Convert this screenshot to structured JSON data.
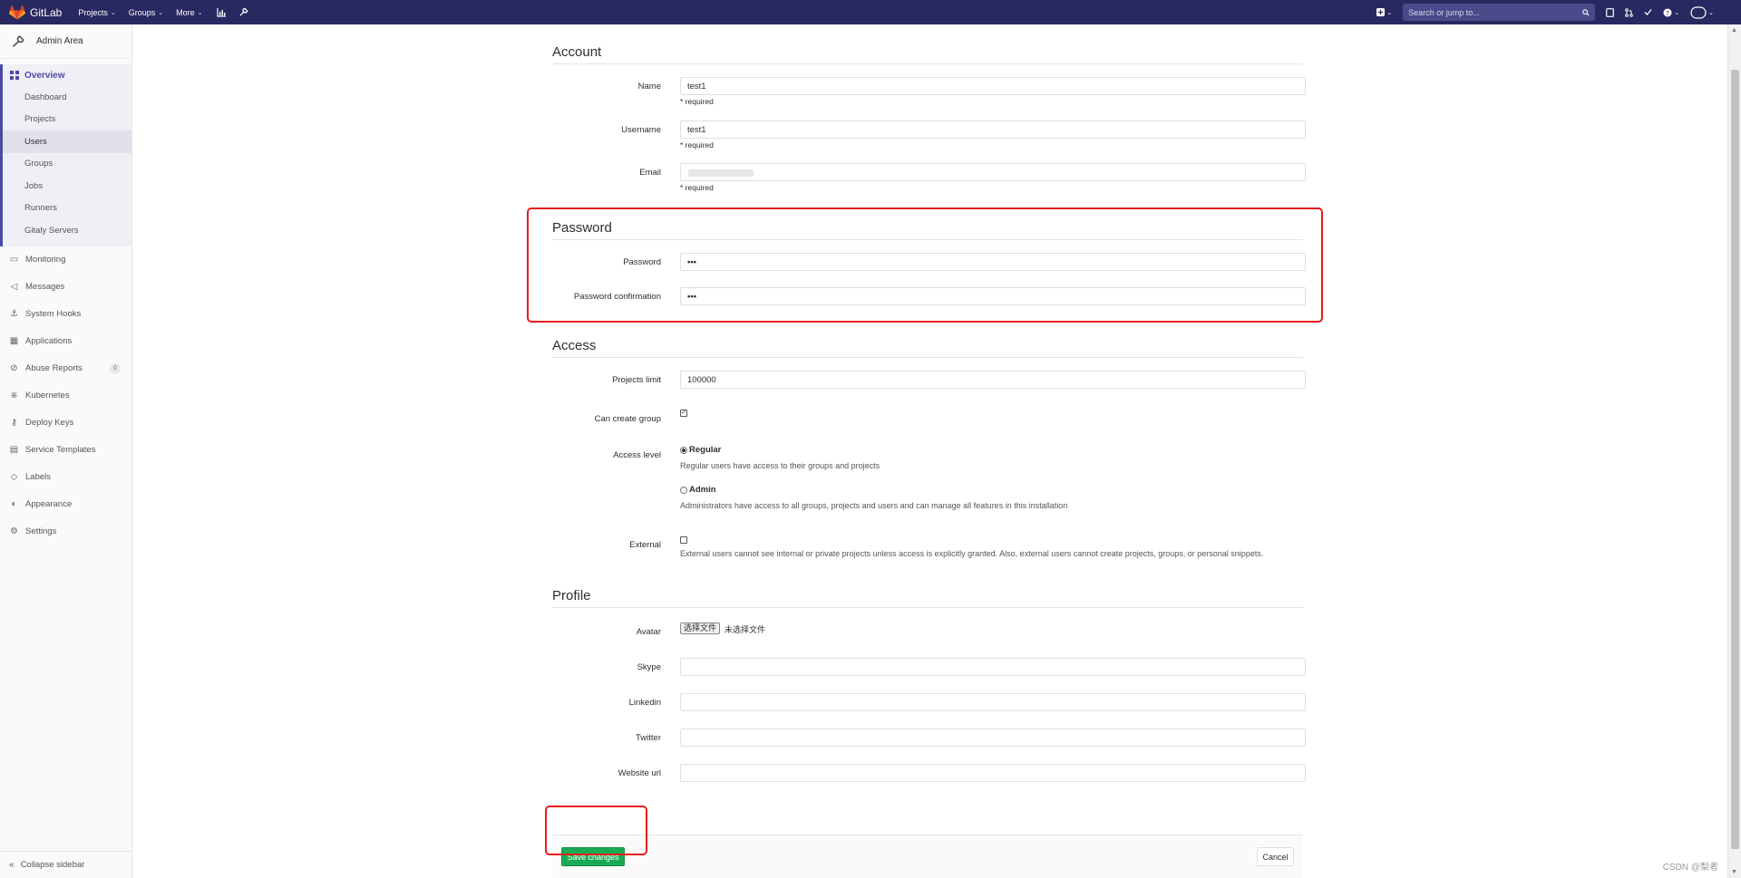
{
  "navbar": {
    "brand": "GitLab",
    "menu": [
      {
        "label": "Projects"
      },
      {
        "label": "Groups"
      },
      {
        "label": "More"
      }
    ],
    "search_placeholder": "Search or jump to..."
  },
  "sidebar": {
    "header": "Admin Area",
    "overview": "Overview",
    "sub_items": [
      "Dashboard",
      "Projects",
      "Users",
      "Groups",
      "Jobs",
      "Runners",
      "Gitaly Servers"
    ],
    "active_sub_item": "Users",
    "items": [
      "Monitoring",
      "Messages",
      "System Hooks",
      "Applications",
      "Abuse Reports",
      "Kubernetes",
      "Deploy Keys",
      "Service Templates",
      "Labels",
      "Appearance",
      "Settings"
    ],
    "abuse_count": "0",
    "collapse": "Collapse sidebar"
  },
  "account": {
    "title": "Account",
    "name_label": "Name",
    "name_value": "test1",
    "username_label": "Username",
    "username_value": "test1",
    "email_label": "Email",
    "required": "* required"
  },
  "password": {
    "title": "Password",
    "password_label": "Password",
    "password_value": "•••",
    "confirmation_label": "Password confirmation",
    "confirmation_value": "•••"
  },
  "access": {
    "title": "Access",
    "projects_limit_label": "Projects limit",
    "projects_limit_value": "100000",
    "can_create_group_label": "Can create group",
    "access_level_label": "Access level",
    "regular_label": "Regular",
    "regular_help": "Regular users have access to their groups and projects",
    "admin_label": "Admin",
    "admin_help": "Administrators have access to all groups, projects and users and can manage all features in this installation",
    "external_label": "External",
    "external_help": "External users cannot see internal or private projects unless access is explicitly granted. Also, external users cannot create projects, groups, or personal snippets."
  },
  "profile": {
    "title": "Profile",
    "avatar_label": "Avatar",
    "file_button": "选择文件",
    "file_status": "未选择文件",
    "skype_label": "Skype",
    "linkedin_label": "Linkedin",
    "twitter_label": "Twitter",
    "website_label": "Website url"
  },
  "actions": {
    "save": "Save changes",
    "cancel": "Cancel"
  },
  "watermark": "CSDN @梨者"
}
